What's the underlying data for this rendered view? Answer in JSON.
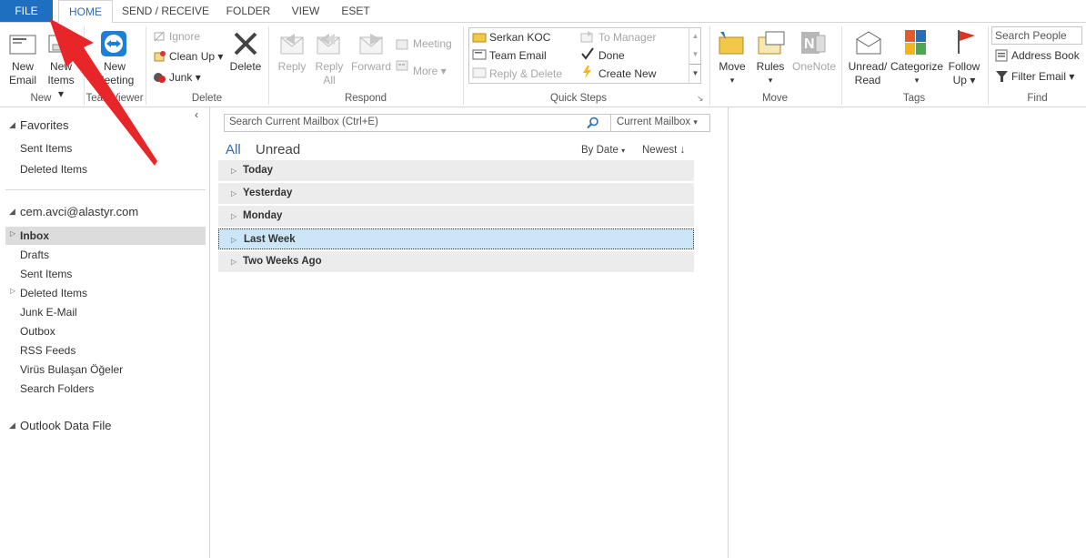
{
  "tabs": [
    "FILE",
    "HOME",
    "SEND / RECEIVE",
    "FOLDER",
    "VIEW",
    "ESET"
  ],
  "ribbon": {
    "new": {
      "label": "New",
      "new_email": "New\nEmail",
      "new_items": "New\nItems",
      "new_items_l1": "New",
      "new_items_l2": "Items"
    },
    "teamviewer": {
      "label": "TeamViewer",
      "new_meeting_l1": "New",
      "new_meeting_l2": "Meeting"
    },
    "delete_group": {
      "label": "Delete",
      "ignore": "Ignore",
      "clean_up": "Clean Up",
      "junk": "Junk",
      "delete": "Delete"
    },
    "respond": {
      "label": "Respond",
      "reply": "Reply",
      "reply_all_l1": "Reply",
      "reply_all_l2": "All",
      "forward": "Forward",
      "meeting": "Meeting",
      "more": "More"
    },
    "quick_steps": {
      "label": "Quick Steps",
      "items": [
        "Serkan KOC",
        "Team Email",
        "Reply & Delete",
        "To Manager",
        "Done",
        "Create New"
      ]
    },
    "move": {
      "label": "Move",
      "move": "Move",
      "rules": "Rules",
      "onenote": "OneNote"
    },
    "tags": {
      "label": "Tags",
      "unread_l1": "Unread/",
      "unread_l2": "Read",
      "categorize": "Categorize",
      "follow_l1": "Follow",
      "follow_l2": "Up"
    },
    "find": {
      "label": "Find",
      "search_people": "Search People",
      "address_book": "Address Book",
      "filter_email": "Filter Email"
    }
  },
  "nav": {
    "favorites": "Favorites",
    "fav_items": [
      "Sent Items",
      "Deleted Items"
    ],
    "account": "cem.avci@alastyr.com",
    "folders": [
      "Inbox",
      "Drafts",
      "Sent Items",
      "Deleted Items",
      "Junk E-Mail",
      "Outbox",
      "RSS Feeds",
      "Virüs Bulaşan Öğeler",
      "Search Folders"
    ],
    "data_file": "Outlook Data File"
  },
  "mail": {
    "search_placeholder": "Search Current Mailbox (Ctrl+E)",
    "scope": "Current Mailbox",
    "filter_all": "All",
    "filter_unread": "Unread",
    "sort_by": "By Date",
    "order": "Newest",
    "groups": [
      "Today",
      "Yesterday",
      "Monday",
      "Last Week",
      "Two Weeks Ago"
    ]
  },
  "colors": {
    "accent": "#1e6fc0",
    "annotation_arrow": "#e8262a",
    "selected_group": "#cde6f7"
  }
}
